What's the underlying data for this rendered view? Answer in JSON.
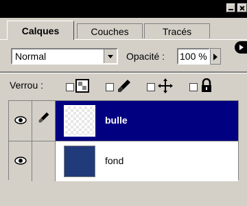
{
  "tabs": [
    {
      "label": "Calques"
    },
    {
      "label": "Couches"
    },
    {
      "label": "Tracés"
    }
  ],
  "blend": {
    "mode": "Normal"
  },
  "opacity": {
    "label": "Opacité :",
    "value": "100 %"
  },
  "lock": {
    "label": "Verrou :"
  },
  "layers": [
    {
      "name": "bulle",
      "visible": true
    },
    {
      "name": "fond",
      "visible": true
    }
  ],
  "icons": {
    "eye": "eye-icon",
    "brush": "brush-icon",
    "lock_transparency": "checker-icon",
    "lock_paint": "brush-icon",
    "lock_move": "move-icon",
    "lock_all": "padlock-icon"
  },
  "colors": {
    "selection": "#000080",
    "fond_fill": "#213a79",
    "panel": "#d4d0c8"
  }
}
